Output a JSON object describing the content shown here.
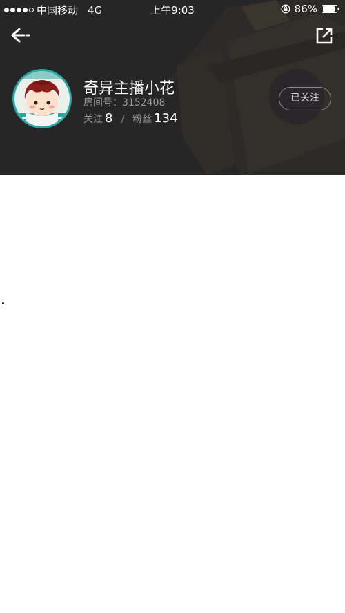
{
  "status_bar": {
    "carrier": "中国移动",
    "network": "4G",
    "time": "上午9:03",
    "battery": "86%",
    "signal_bars_filled": 4,
    "signal_bars_total": 5
  },
  "header": {
    "back_icon": "arrow-left-icon",
    "share_icon": "share-external-icon"
  },
  "profile": {
    "name": "奇异主播小花",
    "room_label": "房间号：",
    "room_number": "3152408",
    "following_label": "关注",
    "following_count": "8",
    "separator": "/",
    "fans_label": "粉丝",
    "fans_count": "134",
    "follow_button": "已关注"
  },
  "colors": {
    "header_bg": "#262626",
    "text_primary": "#ffffff",
    "text_secondary": "#9a9a9a"
  }
}
